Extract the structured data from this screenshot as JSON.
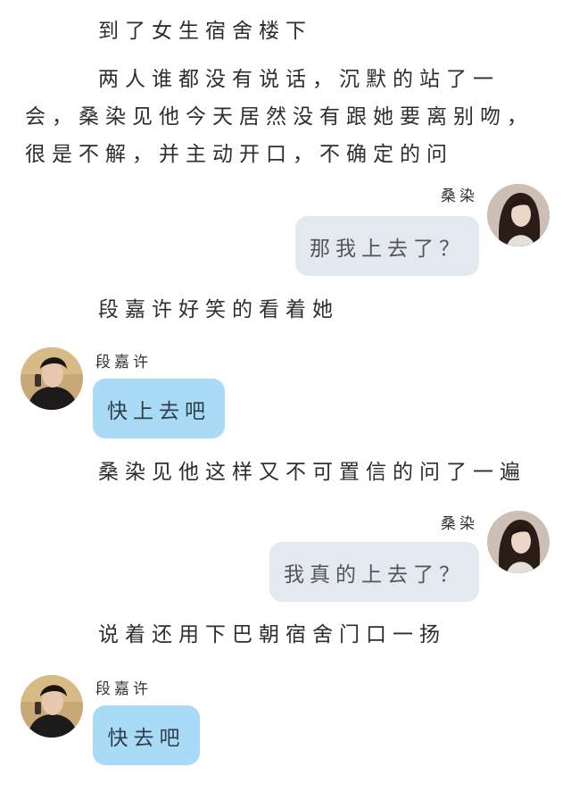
{
  "narration": [
    "到了女生宿舍楼下",
    "两人谁都没有说话，沉默的站了一会，桑染见他今天居然没有跟她要离别吻，很是不解，并主动开口，不确定的问",
    "段嘉许好笑的看着她",
    "桑染见他这样又不可置信的问了一遍",
    "说着还用下巴朝宿舍门口一扬"
  ],
  "messages": [
    {
      "speaker": "桑染",
      "text": "那我上去了？",
      "side": "right"
    },
    {
      "speaker": "段嘉许",
      "text": "快上去吧",
      "side": "left"
    },
    {
      "speaker": "桑染",
      "text": "我真的上去了？",
      "side": "right"
    },
    {
      "speaker": "段嘉许",
      "text": "快去吧",
      "side": "left"
    }
  ],
  "colors": {
    "right_bubble": "#e4e9f0",
    "left_bubble": "#a9dbf7"
  },
  "icons": {
    "female_avatar": "avatar-female-icon",
    "male_avatar": "avatar-male-icon"
  }
}
